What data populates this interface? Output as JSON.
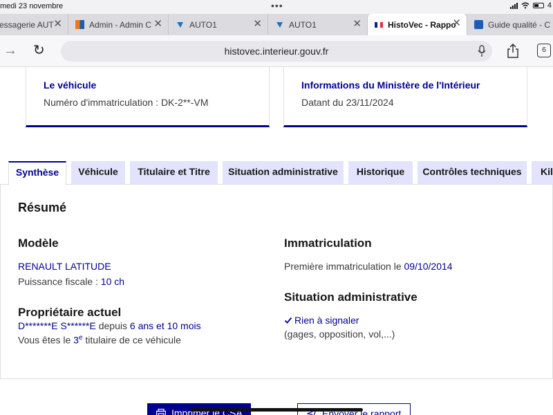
{
  "status_bar": {
    "date": "medi 23 novembre",
    "dots": "•••",
    "battery_text": "4"
  },
  "browser_tabs": [
    {
      "label": "essagerie AUT",
      "icon": "mail-icon"
    },
    {
      "label": "Admin - Admin C",
      "icon": "admin-icon"
    },
    {
      "label": "AUTO1",
      "icon": "auto1-icon"
    },
    {
      "label": "AUTO1",
      "icon": "auto1-icon"
    },
    {
      "label": "HistoVec - Rappo",
      "icon": "french-flag-icon",
      "active": true
    },
    {
      "label": "Guide qualité - C",
      "icon": "doc-icon"
    }
  ],
  "address_bar": {
    "url": "histovec.interieur.gouv.fr",
    "tab_count": "6"
  },
  "cards": {
    "vehicle": {
      "title": "Le véhicule",
      "text": "Numéro d'immatriculation : DK-2**-VM"
    },
    "ministry": {
      "title": "Informations du Ministère de l'Intérieur",
      "text": "Datant du 23/11/2024"
    }
  },
  "page_tabs": [
    {
      "label": "Synthèse",
      "active": true
    },
    {
      "label": "Véhicule"
    },
    {
      "label": "Titulaire et Titre"
    },
    {
      "label": "Situation administrative"
    },
    {
      "label": "Historique"
    },
    {
      "label": "Contrôles techniques"
    },
    {
      "label": "Kilo"
    }
  ],
  "summary": {
    "heading": "Résumé",
    "model": {
      "heading": "Modèle",
      "name": "RENAULT LATITUDE",
      "power_label": "Puissance fiscale : ",
      "power_value": "10 ch"
    },
    "owner": {
      "heading": "Propriétaire actuel",
      "name": "D*******E S******E",
      "since_label": " depuis ",
      "since_value": "6 ans et 10 mois",
      "rank_prefix": "Vous êtes le ",
      "rank_number": "3",
      "rank_suffix": "e",
      "rank_rest": " titulaire de ce véhicule"
    },
    "registration": {
      "heading": "Immatriculation",
      "first_label": "Première immatriculation le ",
      "first_date": "09/10/2014"
    },
    "admin": {
      "heading": "Situation administrative",
      "status": "Rien à signaler",
      "details": "(gages, opposition, vol,...)"
    }
  },
  "actions": {
    "print": "Imprimer le CSA",
    "send": "Envoyer le rapport"
  }
}
